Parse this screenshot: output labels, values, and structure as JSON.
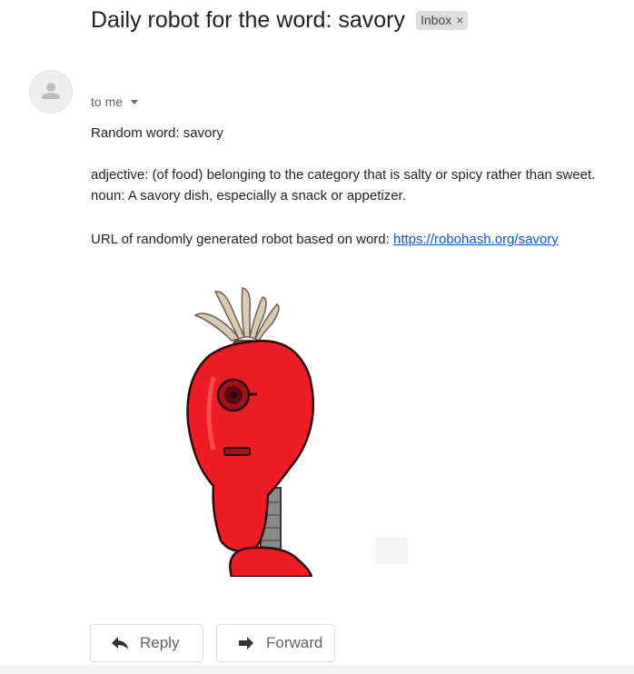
{
  "email": {
    "subject": "Daily robot for the word: savory",
    "label": "Inbox",
    "label_remove": "×",
    "recipient": "to me",
    "body": {
      "random_word_line": "Random word: savory",
      "adjective_line": "adjective: (of food) belonging to the category that is salty or spicy rather than sweet.",
      "noun_line": "noun: A savory dish, especially a snack or appetizer.",
      "url_prefix": "URL of randomly generated robot based on word: ",
      "url_link": "https://robohash.org/savory"
    }
  },
  "actions": {
    "reply_label": "Reply",
    "forward_label": "Forward"
  },
  "icons": {
    "avatar": "person-icon",
    "caret": "chevron-down-icon",
    "reply": "reply-arrow-icon",
    "forward": "forward-arrow-icon"
  },
  "colors": {
    "link": "#1155cc",
    "robot_red": "#ee1c24",
    "chip_bg": "#dddddd"
  }
}
